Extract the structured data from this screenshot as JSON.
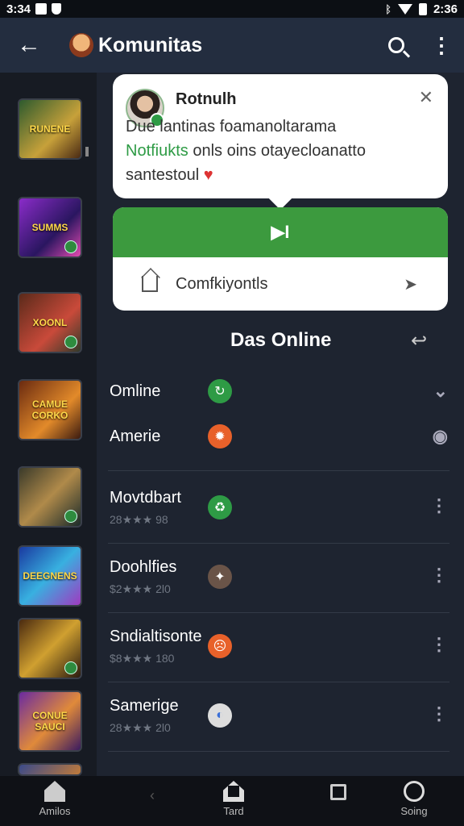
{
  "status_bar": {
    "time_left": "3:34",
    "time_right": "2:36"
  },
  "app_bar": {
    "title": "Komunitas",
    "icons": [
      "back-arrow-icon",
      "app-logo",
      "search-icon",
      "more-vert-icon"
    ]
  },
  "notification": {
    "title": "Rotnulh",
    "line1": "Due lantinas foamanoltarama",
    "line2_highlight": "Notfiukts",
    "line2_rest": " onls oins otayecloanatto",
    "line3": "santestoul",
    "heart": "♥",
    "close": "✕"
  },
  "action_card": {
    "primary_label": "▶I",
    "row_label": "Comfkiyontls",
    "row_arrow": "➤"
  },
  "section": {
    "title": "Das Online",
    "share": "↩"
  },
  "sidebar": {
    "thumbs": [
      {
        "label": "RUNENE"
      },
      {
        "label": "SUMMS"
      },
      {
        "label": "XOONL"
      },
      {
        "label": "CAMUE CORKO"
      },
      {
        "label": ""
      },
      {
        "label": "DEEGNENS"
      },
      {
        "label": ""
      },
      {
        "label": "CONUE SAUCI"
      }
    ]
  },
  "list": {
    "simple_rows": [
      {
        "name": "Omline",
        "status_color": "#2e9b45",
        "trailing": "⌄"
      },
      {
        "name": "Amerie",
        "status_color": "#e8612a",
        "trailing": "◉"
      }
    ],
    "rows": [
      {
        "name": "Movtdbart",
        "sub": "28★★★ 98",
        "status_color": "#2e9b45",
        "menu": "⋮"
      },
      {
        "name": "Doohlfies",
        "sub": "$2★★★ 2l0",
        "status_color": "#6a5448",
        "menu": "⋮"
      },
      {
        "name": "Sndialtisonte",
        "sub": "$8★★★ 180",
        "status_color": "#e8612a",
        "menu": "⋮"
      },
      {
        "name": "Samerige",
        "sub": "28★★★ 2l0",
        "status_color": "#3a6fd8",
        "menu": "⋮"
      }
    ]
  },
  "bottom_nav": {
    "items": [
      {
        "label": "Amilos",
        "icon": "home-icon"
      },
      {
        "label": "Tard",
        "icon": "house-outline-icon"
      },
      {
        "label": "",
        "icon": "square-icon"
      },
      {
        "label": "Soing",
        "icon": "circle-check-icon"
      }
    ],
    "back": "‹"
  }
}
